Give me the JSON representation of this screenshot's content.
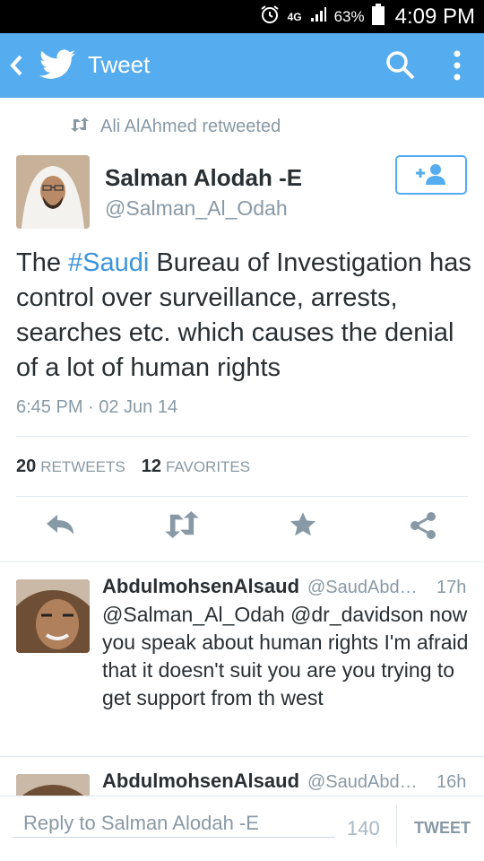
{
  "status_bar": {
    "network": "4G",
    "battery": "63%",
    "time": "4:09 PM"
  },
  "app_bar": {
    "title": "Tweet",
    "color": "#55acee"
  },
  "tweet": {
    "retweeted_by": "Ali AlAhmed retweeted",
    "author_name": "Salman Alodah -E",
    "author_handle": "@Salman_Al_Odah",
    "text_before": "The ",
    "hashtag": "#Saudi",
    "text_after": " Bureau of Investigation has control over surveillance, arrests, searches etc. which causes the denial of a lot of human rights",
    "timestamp": "6:45 PM · 02 Jun 14",
    "retweets_count": "20",
    "retweets_label": "RETWEETS",
    "favorites_count": "12",
    "favorites_label": "FAVORITES"
  },
  "replies": [
    {
      "name": "AbdulmohsenAlsaud",
      "handle": "@SaudAbdul...",
      "time": "17h",
      "text": "@Salman_Al_Odah @dr_davidson now you speak about human rights I'm afraid that it doesn't suit you are you trying to get support from th west"
    },
    {
      "name": "AbdulmohsenAlsaud",
      "handle": "@SaudAbdul...",
      "time": "16h",
      "text": ""
    }
  ],
  "compose": {
    "placeholder": "Reply to Salman Alodah -E",
    "counter": "140",
    "tweet_label": "TWEET"
  },
  "icons": [
    "alarm-icon",
    "signal-icon",
    "battery-icon",
    "back-icon",
    "twitter-bird-icon",
    "search-icon",
    "overflow-menu-icon",
    "retweet-icon",
    "follow-icon",
    "reply-icon",
    "favorite-icon",
    "share-icon"
  ]
}
